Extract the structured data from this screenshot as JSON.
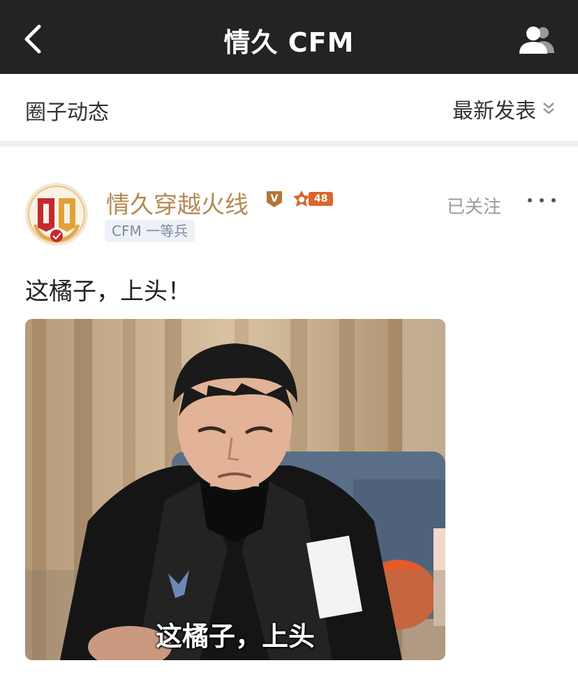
{
  "nav": {
    "title": "情久 CFM",
    "back_icon": "chevron-left-icon",
    "members_icon": "group-users-icon"
  },
  "section": {
    "title": "圈子动态",
    "sort_label": "最新发表",
    "sort_icon": "double-chevron-down-icon"
  },
  "post": {
    "author": "情久穿越火线",
    "verified_badge": "V",
    "level": "48",
    "rank": "CFM 一等兵",
    "follow_status": "已关注",
    "more_icon": "more-dots-icon",
    "text": "这橘子，上头！",
    "image_caption": "这橘子，上头"
  },
  "colors": {
    "navbar": "#232326",
    "author_name": "#b48a56",
    "level_badge": "#d9662c",
    "divider": "#eef0f3"
  }
}
